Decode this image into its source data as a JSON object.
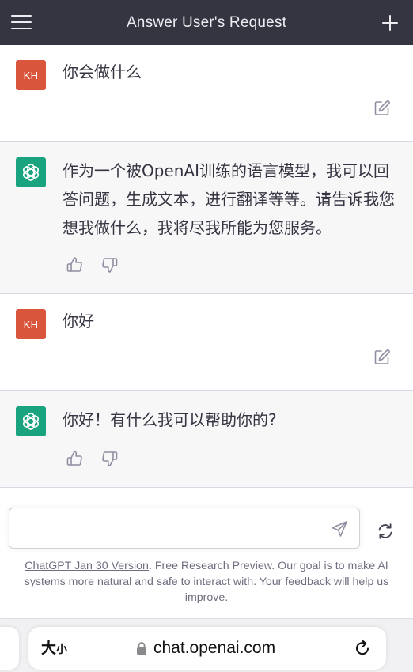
{
  "header": {
    "title": "Answer User's Request",
    "background": "#343541",
    "menu_icon": "hamburger-menu-icon",
    "new_chat_icon": "plus-icon"
  },
  "conversation": [
    {
      "role": "user",
      "avatar": "KH",
      "text": "你会做什么"
    },
    {
      "role": "assistant",
      "avatar_icon": "openai-logo-icon",
      "text": "作为一个被OpenAI训练的语言模型，我可以回答问题，生成文本，进行翻译等等。请告诉我您想我做什么，我将尽我所能为您服务。"
    },
    {
      "role": "user",
      "avatar": "KH",
      "text": "你好"
    },
    {
      "role": "assistant",
      "avatar_icon": "openai-logo-icon",
      "text": "你好！有什么我可以帮助你的?"
    }
  ],
  "composer": {
    "value": "",
    "placeholder": "",
    "send_icon": "paper-plane-send-icon",
    "regenerate_icon": "refresh-icon"
  },
  "footer": {
    "version_link": "ChatGPT Jan 30 Version",
    "note": ". Free Research Preview. Our goal is to make AI systems more natural and safe to interact with. Your feedback will help us improve."
  },
  "browser": {
    "text_size_big": "大",
    "text_size_small": "小",
    "url": "chat.openai.com"
  },
  "colors": {
    "user_avatar": "#d9553b",
    "assistant_avatar": "#19a37f",
    "assistant_bg": "#f7f7f8"
  }
}
